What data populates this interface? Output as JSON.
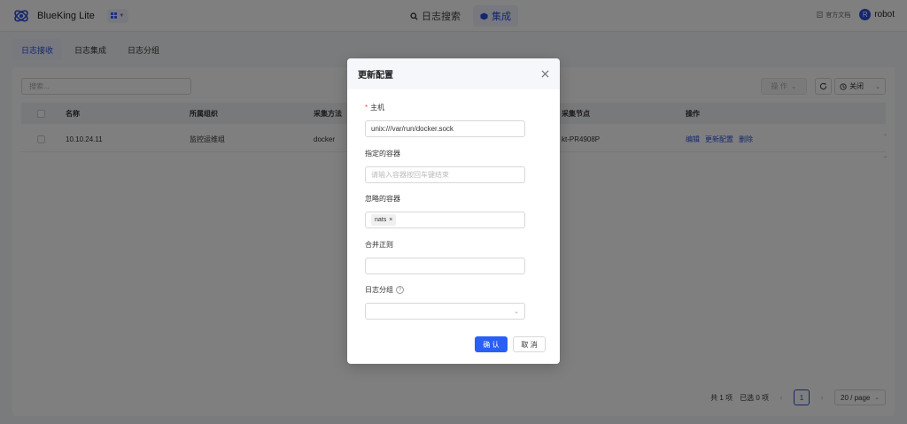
{
  "header": {
    "app_name": "BlueKing Lite",
    "nav": [
      {
        "label": "日志搜索",
        "active": false
      },
      {
        "label": "集成",
        "active": true
      }
    ],
    "doc_label": "官方文档",
    "user": {
      "name": "robot",
      "initial": "R"
    }
  },
  "subtabs": [
    {
      "label": "日志接收",
      "active": true
    },
    {
      "label": "日志集成",
      "active": false
    },
    {
      "label": "日志分组",
      "active": false
    }
  ],
  "toolbar": {
    "search_placeholder": "搜索...",
    "action_label": "操 作",
    "close_label": "关闭"
  },
  "table": {
    "columns": [
      "名称",
      "所属组织",
      "采集方法",
      "采集节点",
      "操作"
    ],
    "rows": [
      {
        "name": "10.10.24.11",
        "org": "监控运维组",
        "method": "docker",
        "node": "kt-PR4908P",
        "actions": [
          "编辑",
          "更新配置",
          "删除"
        ]
      }
    ]
  },
  "pagination": {
    "total": "共 1 项",
    "selected": "已选 0 项",
    "current_page": "1",
    "page_size": "20 / page"
  },
  "modal": {
    "title": "更新配置",
    "required_mark": "*",
    "host_label": "主机",
    "host_value": "unix:///var/run/docker.sock",
    "containers_label": "指定的容器",
    "containers_placeholder": "请输入容器按回车键结束",
    "ignore_label": "忽略的容器",
    "ignore_tags": [
      "nats"
    ],
    "merge_label": "合并正则",
    "merge_value": "",
    "group_label": "日志分组",
    "group_value": "",
    "confirm_label": "确 认",
    "cancel_label": "取 消"
  },
  "colors": {
    "primary": "#2a5ff5",
    "overlay": "rgba(0,0,0,0.5)"
  }
}
